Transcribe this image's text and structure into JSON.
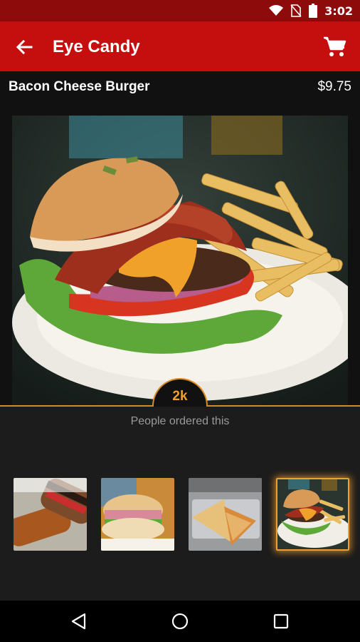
{
  "status_bar": {
    "time": "3:02",
    "icons": [
      "wifi-icon",
      "no-sim-icon",
      "battery-icon"
    ]
  },
  "app_bar": {
    "title": "Eye Candy",
    "back_icon": "arrow-left-icon",
    "cart_icon": "shopping-cart-icon"
  },
  "item": {
    "name": "Bacon Cheese Burger",
    "price": "$9.75"
  },
  "orders": {
    "count": "2k",
    "label": "People ordered this"
  },
  "gallery": {
    "thumbnails": [
      {
        "name": "sub-sandwich-thumb",
        "selected": false
      },
      {
        "name": "club-sandwich-thumb",
        "selected": false
      },
      {
        "name": "grilled-sandwich-thumb",
        "selected": false
      },
      {
        "name": "bacon-burger-thumb",
        "selected": true
      }
    ]
  },
  "colors": {
    "status_bar": "#8e0b0b",
    "app_bar": "#c50f0f",
    "accent": "#f0a030",
    "background": "#111111"
  },
  "nav_bar": {
    "buttons": [
      "back-triangle-icon",
      "home-circle-icon",
      "recents-square-icon"
    ]
  }
}
